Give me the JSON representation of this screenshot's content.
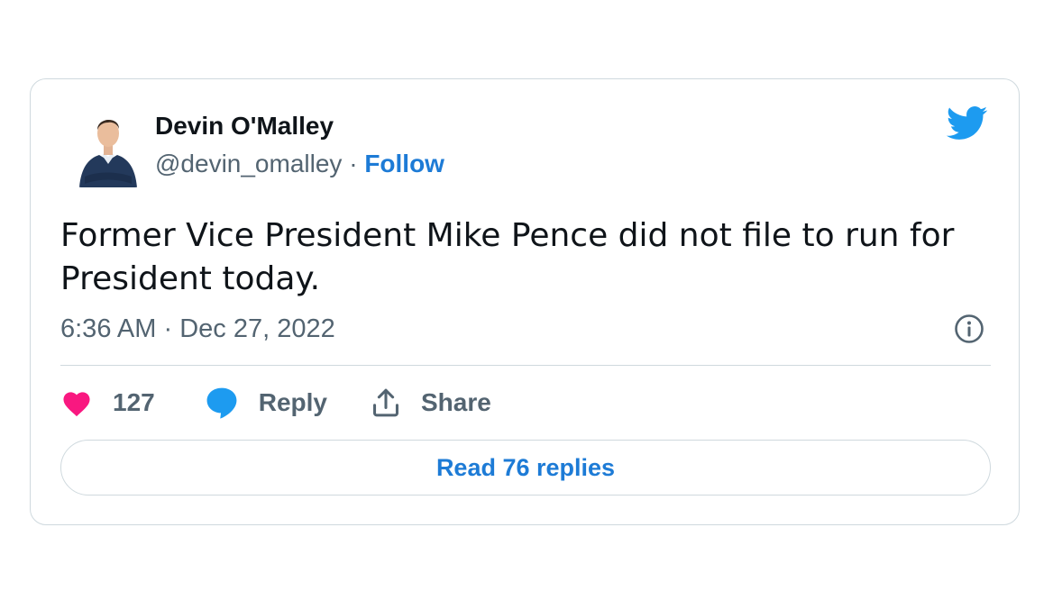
{
  "tweet": {
    "author": {
      "display_name": "Devin O'Malley",
      "handle": "@devin_omalley",
      "follow_label": "Follow",
      "separator": "·"
    },
    "text": "Former Vice President Mike Pence did not file to run for President today.",
    "timestamp": {
      "time": "6:36 AM",
      "separator": "·",
      "date": "Dec 27, 2022"
    },
    "actions": {
      "like_count": "127",
      "reply_label": "Reply",
      "share_label": "Share"
    },
    "read_replies_label": "Read 76 replies"
  },
  "icons": {
    "brand": "twitter-bird-icon",
    "info": "info-icon",
    "like": "heart-icon",
    "reply": "speech-bubble-icon",
    "share": "share-upload-icon"
  },
  "colors": {
    "brand_blue": "#1d9bf0",
    "link_blue": "#1d7bd6",
    "like_pink": "#f91880",
    "text_primary": "#0f1419",
    "text_secondary": "#536471",
    "border": "#cfd9de"
  }
}
